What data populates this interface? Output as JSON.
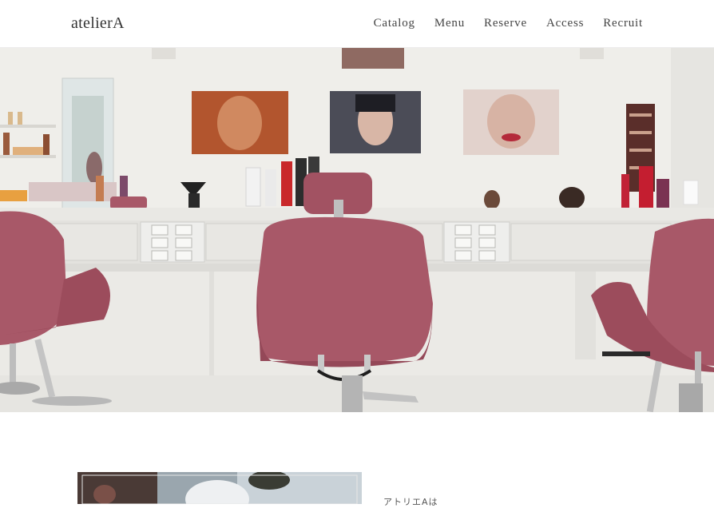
{
  "site": {
    "logo": "atelierA"
  },
  "nav": {
    "items": [
      {
        "label": "Catalog"
      },
      {
        "label": "Menu"
      },
      {
        "label": "Reserve"
      },
      {
        "label": "Access"
      },
      {
        "label": "Recruit"
      }
    ]
  },
  "hero": {
    "image": "salon-interior-photo"
  },
  "about": {
    "image": "salon-staff-photo",
    "heading": "アトリエAは"
  },
  "colors": {
    "chair": "#a85868",
    "wall": "#eceae6",
    "counter": "#e4e2de",
    "text": "#444444"
  }
}
